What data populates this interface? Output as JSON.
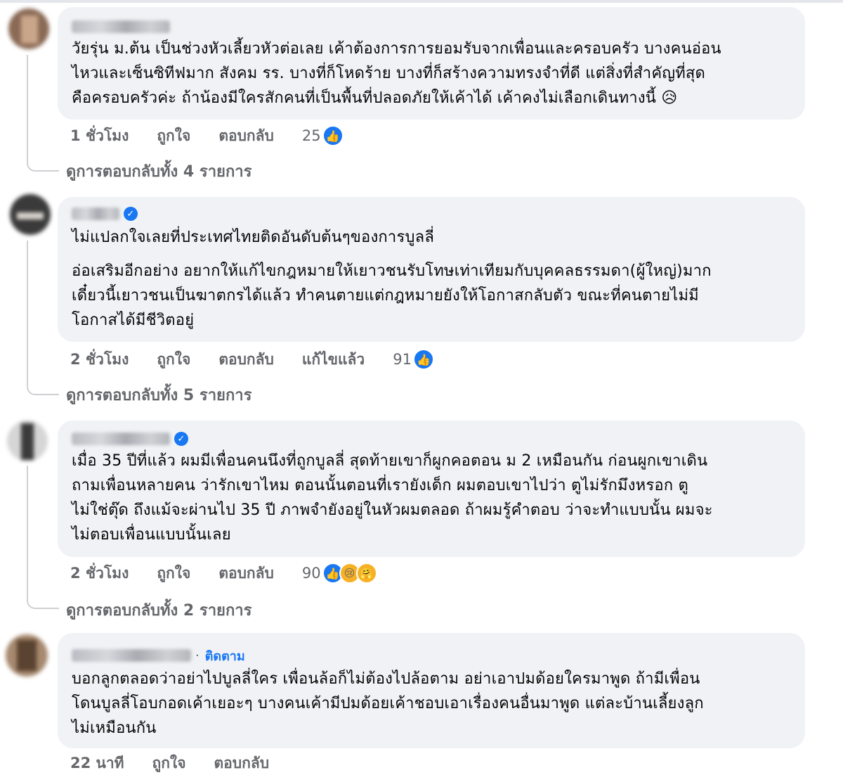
{
  "comments": [
    {
      "paragraphs": [
        "วัยรุ่น ม.ต้น เป็นช่วงหัวเลี้ยวหัวต่อเลย เค้าต้องการการยอมรับจากเพื่อนและครอบครัว บางคนอ่อน\nไหวและเซ็นซิทีฟมาก สังคม รร. บางที่ก็โหดร้าย บางที่ก็สร้างความทรงจำที่ดี แต่สิ่งที่สำคัญที่สุด\nคือครอบครัวค่ะ ถ้าน้องมีใครสักคนที่เป็นพื้นที่ปลอดภัยให้เค้าได้ เค้าคงไม่เลือกเดินทางนี้ 😥"
      ],
      "time": "1 ชั่วโมง",
      "like": "ถูกใจ",
      "reply": "ตอบกลับ",
      "edited": "",
      "reactions": "25",
      "view_replies": "ดูการตอบกลับทั้ง 4 รายการ"
    },
    {
      "paragraphs": [
        "ไม่แปลกใจเลยที่ประเทศไทยติดอันดับต้นๆของการบูลลี่",
        "อ่อเสริมอีกอย่าง อยากให้แก้ไขกฎหมายให้เยาวชนรับโทษเท่าเทียมกับบุคคลธรรมดา(ผู้ใหญ่)มาก\nเดี๋ยวนี้เยาวชนเป็นฆาตกรได้แล้ว ทำคนตายแต่กฎหมายยังให้โอกาสกลับตัว ขณะที่คนตายไม่มี\nโอกาสได้มีชีวิตอยู่"
      ],
      "time": "2 ชั่วโมง",
      "like": "ถูกใจ",
      "reply": "ตอบกลับ",
      "edited": "แก้ไขแล้ว",
      "reactions": "91",
      "view_replies": "ดูการตอบกลับทั้ง 5 รายการ"
    },
    {
      "paragraphs": [
        "เมื่อ 35 ปีที่แล้ว ผมมีเพื่อนคนนึงที่ถูกบูลลี่ สุดท้ายเขาก็ผูกคอตอน ม 2 เหมือนกัน ก่อนผูกเขาเดิน\nถามเพื่อนหลายคน ว่ารักเขาไหม ตอนนั้นตอนที่เรายังเด็ก ผมตอบเขาไปว่า ตูไม่รักมึงหรอก ตู\nไม่ใช่ตุ๊ด ถึงแม้จะผ่านไป 35 ปี ภาพจำยังอยู่ในหัวผมตลอด ถ้าผมรู้คำตอบ ว่าจะทำแบบนั้น ผมจะ\nไม่ตอบเพื่อนแบบนั้นเลย"
      ],
      "time": "2 ชั่วโมง",
      "like": "ถูกใจ",
      "reply": "ตอบกลับ",
      "edited": "",
      "reactions": "90",
      "view_replies": "ดูการตอบกลับทั้ง 2 รายการ"
    },
    {
      "follow": "ติดตาม",
      "paragraphs": [
        "บอกลูกตลอดว่าอย่าไปบูลลี่ใคร เพื่อนล้อก็ไม่ต้องไปล้อตาม อย่าเอาปมด้อยใครมาพูด ถ้ามีเพื่อน\nโดนบูลลี่โอบกอดเค้าเยอะๆ บางคนเค้ามีปมด้อยเค้าชอบเอาเรื่องคนอื่นมาพูด แต่ละบ้านเลี้ยงลูก\nไม่เหมือนกัน"
      ],
      "time": "22 นาที",
      "like": "ถูกใจ",
      "reply": "ตอบกลับ"
    }
  ],
  "icons": {
    "like": "thumbs-up-icon",
    "sad": "sad-face-icon",
    "care": "care-hug-icon",
    "verified": "verified-badge-icon"
  },
  "colors": {
    "bubble": "#f0f2f5",
    "meta": "#65676b",
    "accent": "#1877f2"
  }
}
